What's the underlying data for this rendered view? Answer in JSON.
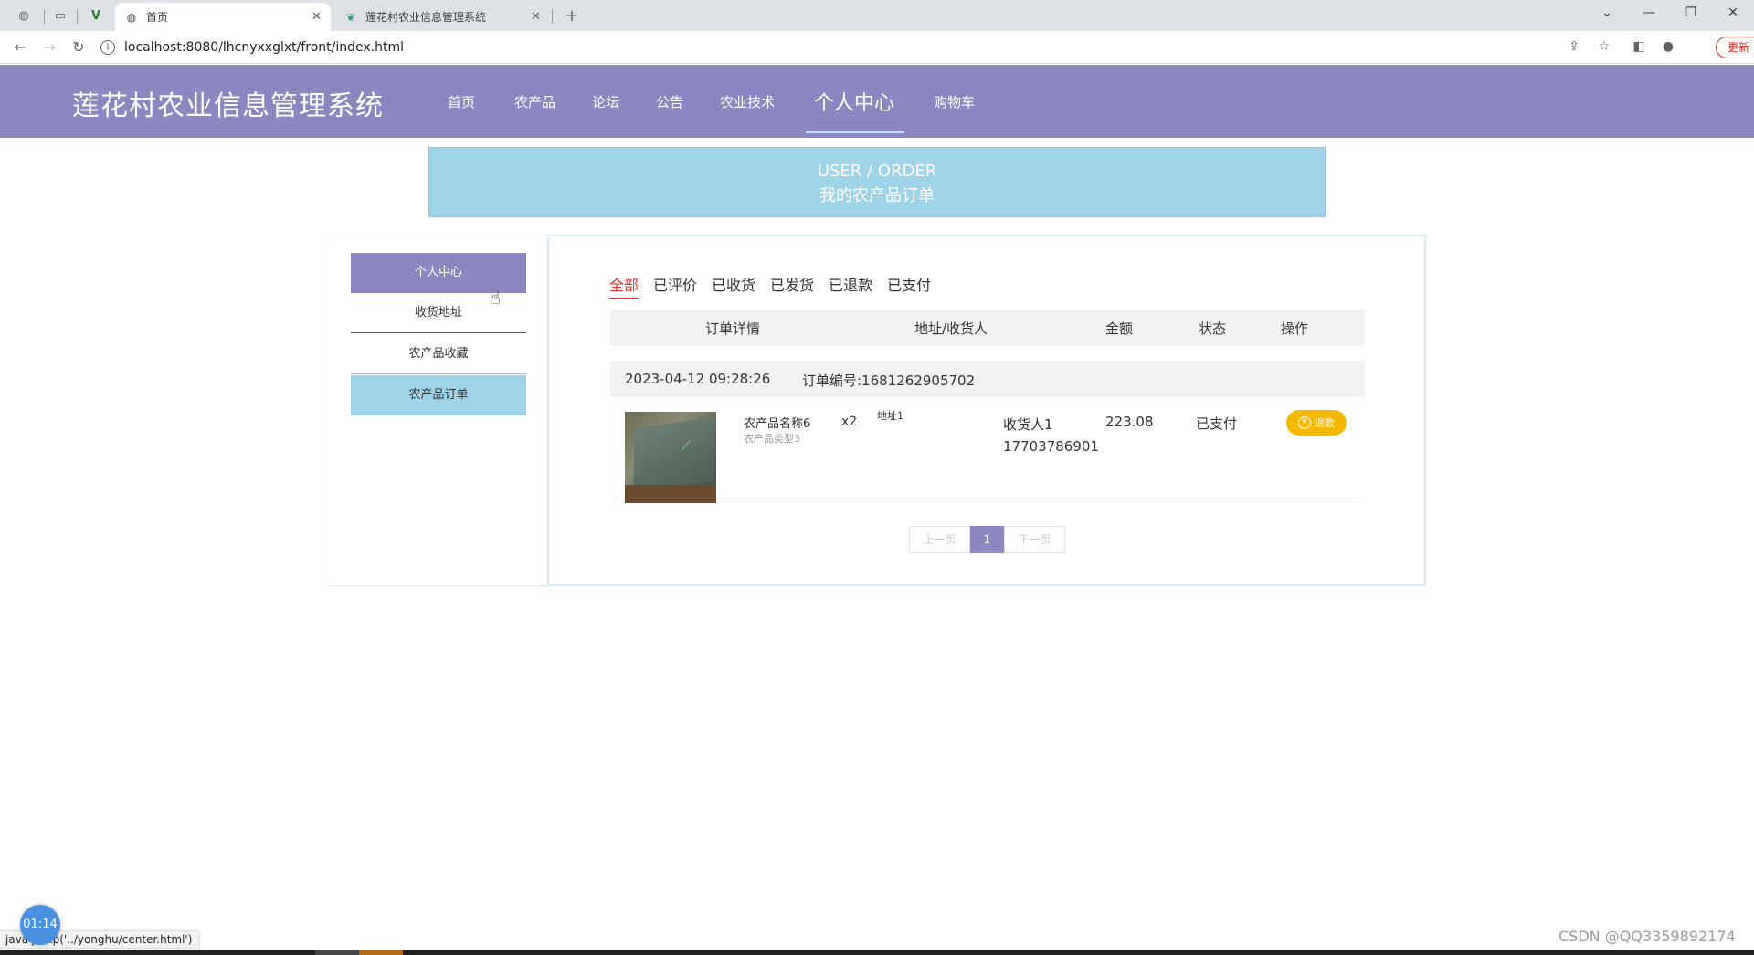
{
  "browser": {
    "tabs": [
      {
        "title": "首页",
        "active": true
      },
      {
        "title": "莲花村农业信息管理系统",
        "active": false
      }
    ],
    "new_tab": "+",
    "url": "localhost:8080/lhcnyxxglxt/front/index.html",
    "update_label": "更新"
  },
  "site": {
    "title": "莲花村农业信息管理系统",
    "nav": [
      {
        "label": "首页",
        "active": false
      },
      {
        "label": "农产品",
        "active": false
      },
      {
        "label": "论坛",
        "active": false
      },
      {
        "label": "公告",
        "active": false
      },
      {
        "label": "农业技术",
        "active": false
      },
      {
        "label": "个人中心",
        "active": true
      },
      {
        "label": "购物车",
        "active": false
      }
    ]
  },
  "banner": {
    "en": "USER / ORDER",
    "cn": "我的农产品订单"
  },
  "sidebar": {
    "items": [
      {
        "label": "个人中心"
      },
      {
        "label": "收货地址"
      },
      {
        "label": "农产品收藏"
      },
      {
        "label": "农产品订单"
      }
    ]
  },
  "orders": {
    "status_tabs": [
      {
        "label": "全部",
        "active": true
      },
      {
        "label": "已评价",
        "active": false
      },
      {
        "label": "已收货",
        "active": false
      },
      {
        "label": "已发货",
        "active": false
      },
      {
        "label": "已退款",
        "active": false
      },
      {
        "label": "已支付",
        "active": false
      }
    ],
    "columns": {
      "detail": "订单详情",
      "address": "地址/收货人",
      "amount": "金额",
      "status": "状态",
      "action": "操作"
    },
    "list": [
      {
        "datetime": "2023-04-12 09:28:26",
        "order_no": "订单编号:1681262905702",
        "product_name": "农产品名称6",
        "product_type": "农产品类型3",
        "quantity": "x2",
        "address": "地址1",
        "receiver": "收货人1",
        "phone": "17703786901",
        "amount": "223.08",
        "status": "已支付",
        "action_label": "退款",
        "action_icon": "yen-icon"
      }
    ],
    "pager": {
      "prev": "上一页",
      "current": "1",
      "next": "下一页"
    }
  },
  "overlays": {
    "timer": "01:14",
    "status_url": "java     jump('../yonghu/center.html')",
    "watermark": "CSDN @QQ3359892174"
  },
  "colors": {
    "header": "#8a87c1",
    "banner": "#9ed3ea",
    "active_tab": "#e0312b",
    "refund": "#f5b800"
  }
}
